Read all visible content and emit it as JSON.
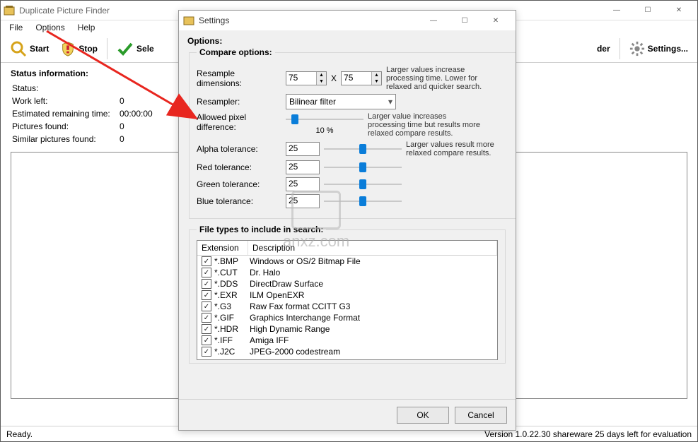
{
  "app": {
    "title": "Duplicate Picture Finder"
  },
  "menu": {
    "file": "File",
    "options": "Options",
    "help": "Help"
  },
  "toolbar": {
    "start": "Start",
    "stop": "Stop",
    "select": "Sele",
    "folder": "der",
    "settings": "Settings..."
  },
  "status": {
    "heading": "Status information:",
    "rows": {
      "status_label": "Status:",
      "status_value": "",
      "workleft_label": "Work left:",
      "workleft_value": "0",
      "eta_label": "Estimated remaining time:",
      "eta_value": "00:00:00",
      "pictures_label": "Pictures found:",
      "pictures_value": "0",
      "similar_label": "Similar pictures found:",
      "similar_value": "0"
    }
  },
  "settings": {
    "title": "Settings",
    "options_label": "Options:",
    "compare_label": "Compare options:",
    "resample_dim_label": "Resample dimensions:",
    "resample_w": "75",
    "resample_x": "X",
    "resample_h": "75",
    "hint_resample": "Larger values increase processing time. Lower for relaxed and quicker search.",
    "resampler_label": "Resampler:",
    "resampler_value": "Bilinear filter",
    "pixeldiff_label": "Allowed pixel difference:",
    "pixeldiff_value": "10 %",
    "hint_pixeldiff": "Larger value increases processing time but results more relaxed compare results.",
    "alpha_label": "Alpha tolerance:",
    "alpha_value": "25",
    "hint_alpha": "Larger values result more relaxed compare results.",
    "red_label": "Red tolerance:",
    "red_value": "25",
    "green_label": "Green tolerance:",
    "green_value": "25",
    "blue_label": "Blue tolerance:",
    "blue_value": "25",
    "filetypes_label": "File types to include in search:",
    "ft_head_ext": "Extension",
    "ft_head_desc": "Description",
    "filetypes": [
      {
        "ext": "*.BMP",
        "desc": "Windows or OS/2 Bitmap File"
      },
      {
        "ext": "*.CUT",
        "desc": "Dr. Halo"
      },
      {
        "ext": "*.DDS",
        "desc": "DirectDraw Surface"
      },
      {
        "ext": "*.EXR",
        "desc": "ILM OpenEXR"
      },
      {
        "ext": "*.G3",
        "desc": "Raw Fax format CCITT G3"
      },
      {
        "ext": "*.GIF",
        "desc": "Graphics Interchange Format"
      },
      {
        "ext": "*.HDR",
        "desc": "High Dynamic Range"
      },
      {
        "ext": "*.IFF",
        "desc": "Amiga IFF"
      },
      {
        "ext": "*.J2C",
        "desc": "JPEG-2000 codestream"
      }
    ],
    "ok": "OK",
    "cancel": "Cancel"
  },
  "statusbar": {
    "ready": "Ready.",
    "version": "Version 1.0.22.30 shareware 25 days left for evaluation"
  },
  "watermark": "anxz.com"
}
